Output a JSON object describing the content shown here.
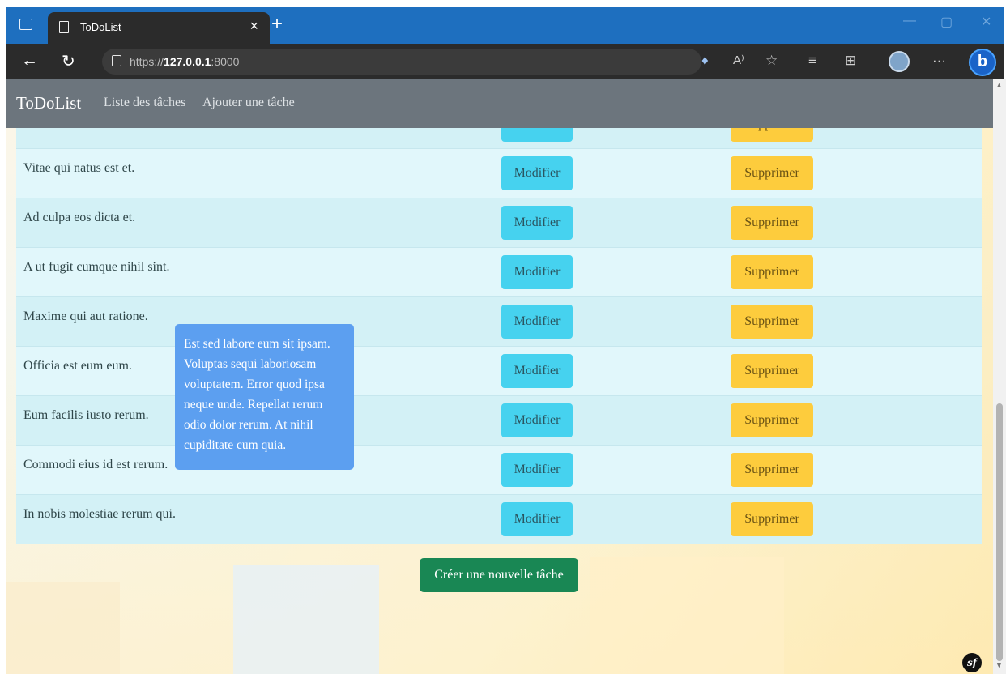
{
  "browser": {
    "tab_title": "ToDoList",
    "tab_close": "×",
    "new_tab": "+",
    "url_prefix": "https://",
    "url_host": "127.0.0.1",
    "url_port": ":8000",
    "window_minimize": "—",
    "window_maximize": "▢",
    "window_close": "✕",
    "bing_label": "b",
    "more_label": "···"
  },
  "navbar": {
    "brand": "ToDoList",
    "links": [
      "Liste des tâches",
      "Ajouter une tâche"
    ]
  },
  "tasks": {
    "partial": {
      "modify": "Modifier",
      "delete": "Supprimer"
    },
    "rows": [
      {
        "title": "Vitae qui natus est et.",
        "modify": "Modifier",
        "delete": "Supprimer"
      },
      {
        "title": "Ad culpa eos dicta et.",
        "modify": "Modifier",
        "delete": "Supprimer"
      },
      {
        "title": "A ut fugit cumque nihil sint.",
        "modify": "Modifier",
        "delete": "Supprimer"
      },
      {
        "title": "Maxime qui aut ratione.",
        "modify": "Modifier",
        "delete": "Supprimer"
      },
      {
        "title": "Officia est eum eum.",
        "modify": "Modifier",
        "delete": "Supprimer"
      },
      {
        "title": "Eum facilis iusto rerum.",
        "modify": "Modifier",
        "delete": "Supprimer"
      },
      {
        "title": "Commodi eius id est rerum.",
        "modify": "Modifier",
        "delete": "Supprimer"
      },
      {
        "title": "In nobis molestiae rerum qui.",
        "modify": "Modifier",
        "delete": "Supprimer"
      }
    ]
  },
  "tooltip": {
    "text": "Est sed labore eum sit ipsam. Voluptas sequi laboriosam voluptatem. Error quod ipsa neque unde. Repellat rerum odio dolor rerum. At nihil cupiditate cum quia."
  },
  "create_button": "Créer une nouvelle tâche",
  "footer": {
    "symfony_logo": "sf"
  },
  "colors": {
    "navbar": "#6c757d",
    "modify_button": "#46d2ef",
    "delete_button": "#fdcc3d",
    "create_button": "#198754",
    "tooltip": "#5c9ff0",
    "row_odd": "#d3f1f6",
    "row_even": "#e1f7fb"
  }
}
